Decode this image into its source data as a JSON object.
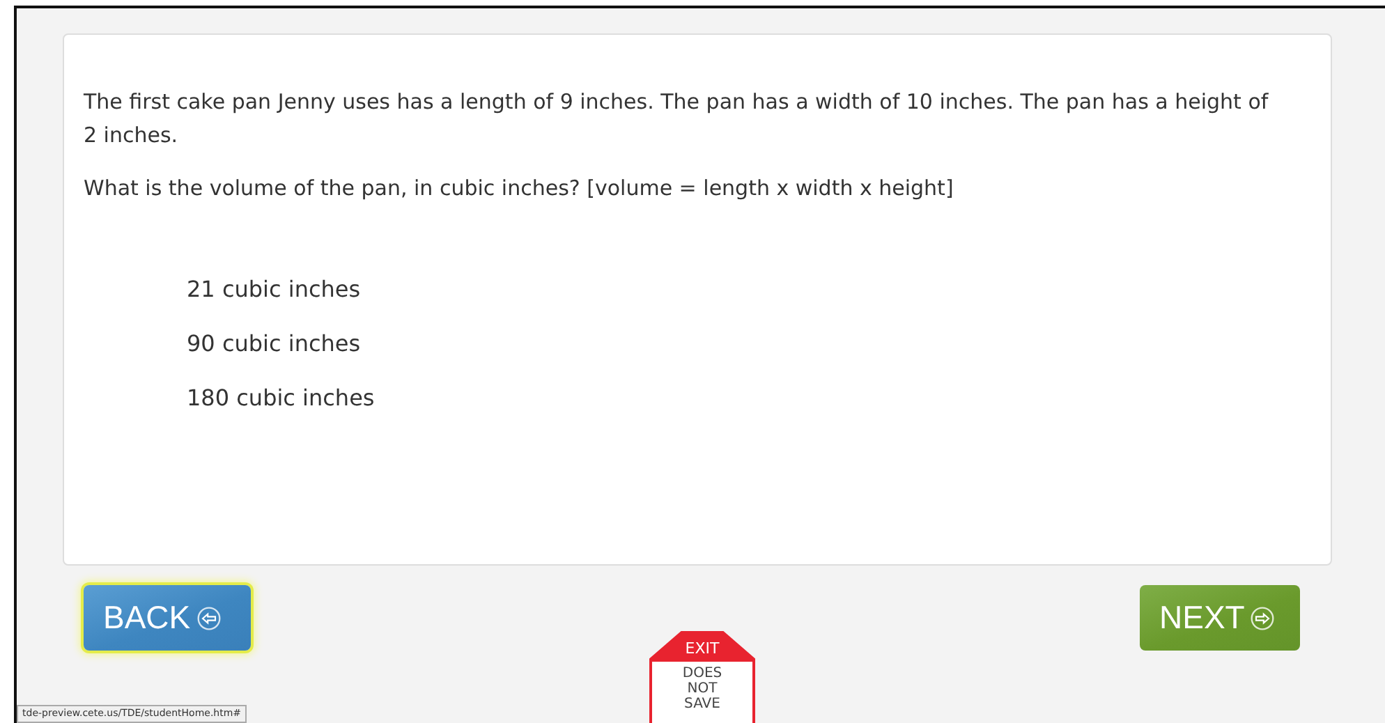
{
  "question": {
    "paragraphs": [
      "The first cake pan Jenny uses has a length of 9 inches. The pan has a width of 10 inches. The pan has a height of 2 inches.",
      "What is the volume of the pan, in cubic inches? [volume = length x width x height]"
    ],
    "options": [
      {
        "label": "21 cubic inches",
        "selected": false
      },
      {
        "label": "90 cubic inches",
        "selected": false
      },
      {
        "label": "180 cubic inches",
        "selected": false
      }
    ]
  },
  "back_button": {
    "label": "BACK",
    "focused": true
  },
  "next_button": {
    "label": "NEXT",
    "focused": false
  },
  "exit_sign": {
    "top": "EXIT",
    "bottom": [
      "DOES",
      "NOT",
      "SAVE"
    ]
  },
  "status_bar": "tde-preview.cete.us/TDE/studentHome.htm#"
}
